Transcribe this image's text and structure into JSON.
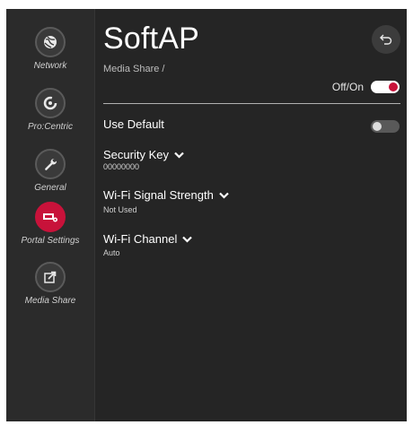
{
  "sidebar": {
    "items": [
      {
        "label": "Network",
        "icon": "network-icon"
      },
      {
        "label": "Pro:Centric",
        "icon": "procentric-icon"
      },
      {
        "label": "General",
        "icon": "wrench-icon"
      },
      {
        "label": "Portal Settings",
        "icon": "portal-settings-icon"
      },
      {
        "label": "Media Share",
        "icon": "media-share-icon"
      }
    ]
  },
  "header": {
    "title": "SoftAP",
    "breadcrumb": "Media Share /"
  },
  "main": {
    "off_on_label": "Off/On",
    "use_default_label": "Use Default",
    "settings": [
      {
        "label": "Security Key",
        "value": "00000000"
      },
      {
        "label": "Wi-Fi Signal Strength",
        "value": "Not Used"
      },
      {
        "label": "Wi-Fi Channel",
        "value": "Auto"
      }
    ]
  },
  "colors": {
    "accent": "#c8123a",
    "background": "#252525",
    "sidebar": "#2b2b2b"
  }
}
